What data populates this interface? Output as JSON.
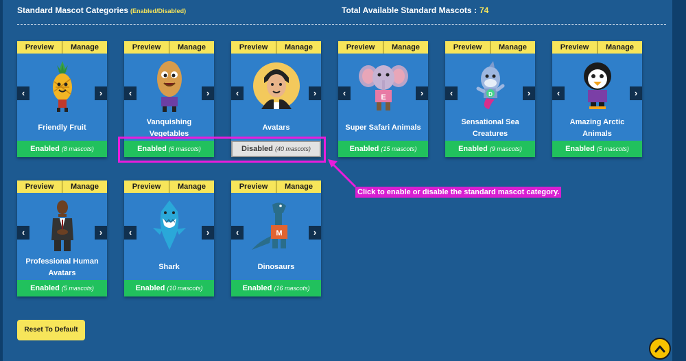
{
  "header": {
    "title": "Standard Mascot Categories",
    "title_sub": "(Enabled/Disabled)",
    "total_label": "Total Available Standard Mascots :",
    "total_count": "74"
  },
  "card_tabs": {
    "preview": "Preview",
    "manage": "Manage"
  },
  "nav": {
    "prev": "‹",
    "next": "›"
  },
  "categories": [
    {
      "name": "Friendly Fruit",
      "status": "Enabled",
      "count": "(8 mascots)",
      "icon": "pineapple-mascot-icon"
    },
    {
      "name": "Vanquishing Vegetables",
      "status": "Enabled",
      "count": "(6 mascots)",
      "icon": "potato-mascot-icon"
    },
    {
      "name": "Avatars",
      "status": "Disabled",
      "count": "(40 mascots)",
      "icon": "avatar-mascot-icon"
    },
    {
      "name": "Super Safari Animals",
      "status": "Enabled",
      "count": "(15 mascots)",
      "icon": "elephant-mascot-icon"
    },
    {
      "name": "Sensational Sea Creatures",
      "status": "Enabled",
      "count": "(9 mascots)",
      "icon": "dolphin-mascot-icon"
    },
    {
      "name": "Amazing Arctic Animals",
      "status": "Enabled",
      "count": "(5 mascots)",
      "icon": "penguin-mascot-icon"
    },
    {
      "name": "Professional Human Avatars",
      "status": "Enabled",
      "count": "(5 mascots)",
      "icon": "businessman-mascot-icon"
    },
    {
      "name": "Shark",
      "status": "Enabled",
      "count": "(10 mascots)",
      "icon": "shark-mascot-icon"
    },
    {
      "name": "Dinosaurs",
      "status": "Enabled",
      "count": "(16 mascots)",
      "icon": "dinosaur-mascot-icon"
    }
  ],
  "callout": "Click to enable or disable the standard mascot category.",
  "reset_label": "Reset To Default",
  "colors": {
    "background": "#1d5a91",
    "card": "#2f7fca",
    "tab": "#f7e55a",
    "enabled": "#21c15d",
    "disabled": "#e2e2e2",
    "highlight": "#e81ddb"
  }
}
